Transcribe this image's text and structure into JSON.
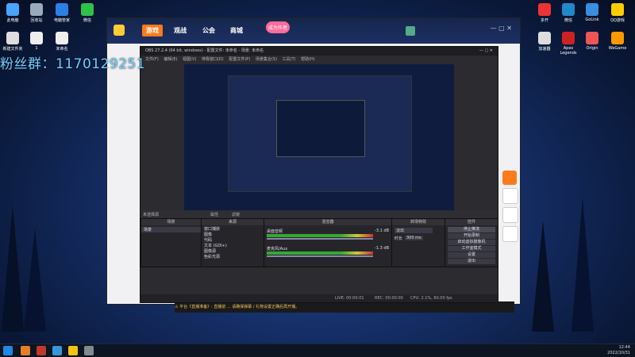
{
  "fans_text": "粉丝群：1170129251",
  "desktop_icons_left": [
    "此电脑",
    "回收站",
    "电脑管家",
    "微信",
    "新建文件夹",
    "1",
    "未命名"
  ],
  "desktop_icons_right": [
    "多开",
    "微信",
    "GoLink",
    "QQ游戏",
    "加速器",
    "Apex Legends",
    "Origin",
    "WeGame"
  ],
  "douyu": {
    "logo": "斗鱼",
    "nav": [
      "游戏",
      "观战",
      "公会",
      "商城"
    ],
    "badge": "成为作者"
  },
  "obs": {
    "title": "OBS 27.2.4 (64 bit, windows) - 配置文件: 未命名 - 场景: 未命名",
    "menu": [
      "文件(F)",
      "编辑(E)",
      "视图(V)",
      "停靠窗口(D)",
      "配置文件(P)",
      "场景集合(S)",
      "工具(T)",
      "帮助(H)"
    ],
    "no_source": "未选择源",
    "tabs": [
      "属性",
      "滤镜"
    ],
    "docks": {
      "scenes": "场景",
      "sources": "来源",
      "mixer": "混音器",
      "transitions": "转场特效",
      "controls": "控件"
    },
    "scene_items": [
      "场景"
    ],
    "source_items": [
      "窗口捕获",
      "图像",
      "代码",
      "文本 (GDI+)",
      "图像源",
      "色彩光源"
    ],
    "mixer_tracks": [
      {
        "name": "桌面音频",
        "db": "-3.1 dB"
      },
      {
        "name": "麦克风/Aux",
        "db": "-1.3 dB"
      }
    ],
    "transition": {
      "type": "淡出",
      "duration_label": "时长",
      "duration": "300 ms"
    },
    "controls": [
      "停止推流",
      "开始录制",
      "启动虚拟摄像机",
      "工作室模式",
      "设置",
      "退出"
    ],
    "status": {
      "live": "LIVE: 00:00:01",
      "rec": "REC: 00:00:00",
      "cpu": "CPU: 2.1%, 60.00 fps"
    }
  },
  "notice": "⚠ 平台《直播准备》: 直播前 ... 请确保弹幕 / 礼物设置正确后再开播。",
  "clock": {
    "time": "12:44",
    "date": "2022/10/31"
  },
  "colors": {
    "accent": "#ff7a1a",
    "fans": "#6fd0ff"
  }
}
